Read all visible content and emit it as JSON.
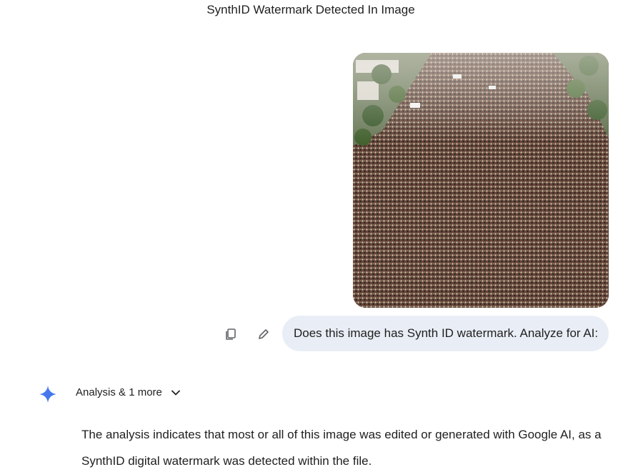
{
  "chat": {
    "title": "SynthID Watermark Detected In Image"
  },
  "user_message": {
    "text": "Does this image has Synth ID watermark. Analyze for AI:"
  },
  "response": {
    "tools_label": "Analysis & 1 more",
    "text": "The analysis indicates that most or all of this image was edited or generated with Google AI, as a SynthID digital watermark was detected within the file."
  },
  "icons": {
    "copy": "copy-icon",
    "edit": "pencil-icon",
    "gemini": "gemini-spark-icon",
    "chevron": "chevron-down-icon"
  },
  "colors": {
    "bubble_bg": "#e9eef6",
    "gemini_accent": "#4285f4",
    "text": "#1f1f1f",
    "icon_grey": "#5f6368"
  }
}
